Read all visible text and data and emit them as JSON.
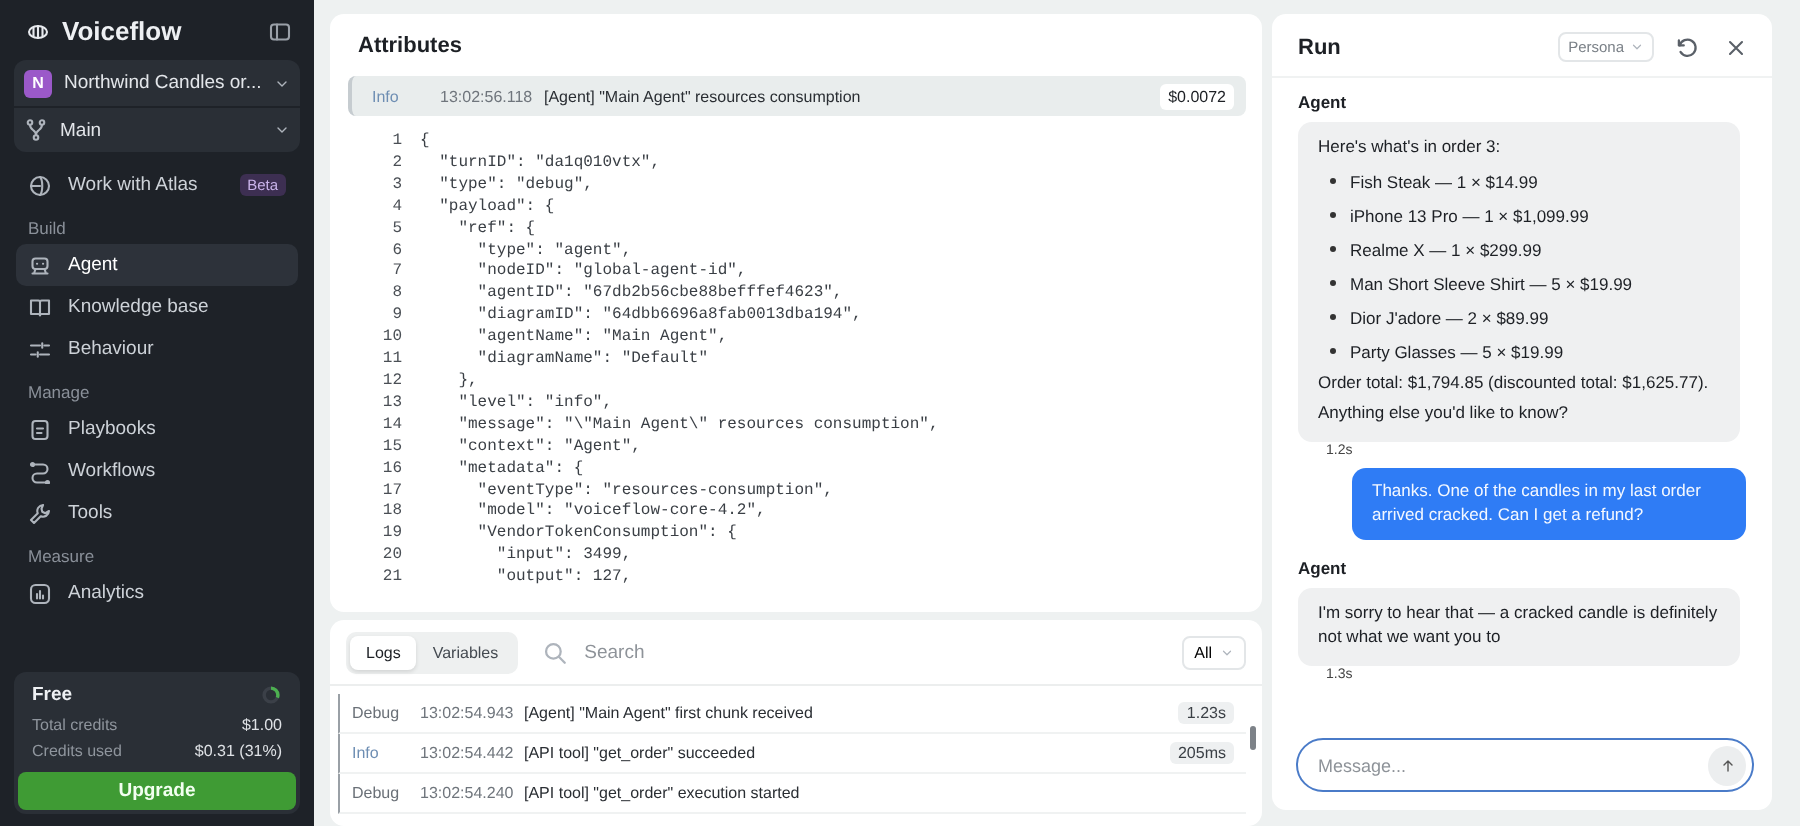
{
  "sidebar": {
    "brand": "Voiceflow",
    "project": {
      "initial": "N",
      "name": "Northwind Candles or..."
    },
    "branch": {
      "name": "Main"
    },
    "atlas": {
      "label": "Work with Atlas",
      "badge": "Beta"
    },
    "groups": [
      {
        "heading": "Build",
        "items": [
          {
            "label": "Agent",
            "selected": true
          },
          {
            "label": "Knowledge base",
            "selected": false
          },
          {
            "label": "Behaviour",
            "selected": false
          }
        ]
      },
      {
        "heading": "Manage",
        "items": [
          {
            "label": "Playbooks",
            "selected": false
          },
          {
            "label": "Workflows",
            "selected": false
          },
          {
            "label": "Tools",
            "selected": false
          }
        ]
      },
      {
        "heading": "Measure",
        "items": [
          {
            "label": "Analytics",
            "selected": false
          }
        ]
      }
    ],
    "plan": {
      "name": "Free",
      "level": 0.31,
      "rows": [
        {
          "label": "Total credits",
          "value": "$1.00"
        },
        {
          "label": "Credits used",
          "value": "$0.31 (31%)"
        }
      ],
      "button": "Upgrade"
    }
  },
  "attributes": {
    "title": "Attributes",
    "entry": {
      "level": "Info",
      "time": "13:02:56.118",
      "message": "[Agent] \"Main Agent\" resources consumption",
      "cost": "$0.0072"
    },
    "code": [
      {
        "n": "1",
        "text": "{"
      },
      {
        "n": "2",
        "text": "  \"turnID\": \"da1q010vtx\","
      },
      {
        "n": "3",
        "text": "  \"type\": \"debug\","
      },
      {
        "n": "4",
        "text": "  \"payload\": {"
      },
      {
        "n": "5",
        "text": "    \"ref\": {"
      },
      {
        "n": "6",
        "text": "      \"type\": \"agent\","
      },
      {
        "n": "7",
        "text": "      \"nodeID\": \"global-agent-id\","
      },
      {
        "n": "8",
        "text": "      \"agentID\": \"67db2b56cbe88befffef4623\","
      },
      {
        "n": "9",
        "text": "      \"diagramID\": \"64dbb6696a8fab0013dba194\","
      },
      {
        "n": "10",
        "text": "      \"agentName\": \"Main Agent\","
      },
      {
        "n": "11",
        "text": "      \"diagramName\": \"Default\""
      },
      {
        "n": "12",
        "text": "    },"
      },
      {
        "n": "13",
        "text": "    \"level\": \"info\","
      },
      {
        "n": "14",
        "text": "    \"message\": \"\\\"Main Agent\\\" resources consumption\","
      },
      {
        "n": "15",
        "text": "    \"context\": \"Agent\","
      },
      {
        "n": "16",
        "text": "    \"metadata\": {"
      },
      {
        "n": "17",
        "text": "      \"eventType\": \"resources-consumption\","
      },
      {
        "n": "18",
        "text": "      \"model\": \"voiceflow-core-4.2\","
      },
      {
        "n": "19",
        "text": "      \"VendorTokenConsumption\": {"
      },
      {
        "n": "20",
        "text": "        \"input\": 3499,"
      },
      {
        "n": "21",
        "text": "        \"output\": 127,"
      }
    ]
  },
  "logs": {
    "tabs": [
      {
        "label": "Logs",
        "selected": true
      },
      {
        "label": "Variables",
        "selected": false
      }
    ],
    "search": {
      "placeholder": "Search"
    },
    "filter": "All",
    "rows": [
      {
        "level": "Debug",
        "kind": "debug",
        "time": "13:02:54.943",
        "message": "[Agent] \"Main Agent\" first chunk received",
        "duration": "1.23s"
      },
      {
        "level": "Info",
        "kind": "info",
        "time": "13:02:54.442",
        "message": "[API tool] \"get_order\" succeeded",
        "duration": "205ms"
      },
      {
        "level": "Debug",
        "kind": "debug",
        "time": "13:02:54.240",
        "message": "[API tool] \"get_order\" execution started"
      }
    ]
  },
  "run": {
    "title": "Run",
    "persona": "Persona",
    "messages": [
      {
        "kind": "agent",
        "sender": "Agent",
        "intro": "Here's what's in order 3:",
        "items": [
          "Fish Steak — 1 × $14.99",
          "iPhone 13 Pro — 1 × $1,099.99",
          "Realme X — 1 × $299.99",
          "Man Short Sleeve Shirt — 5 × $19.99",
          "Dior J'adore — 2 × $89.99",
          "Party Glasses — 5 × $19.99"
        ],
        "paragraphs": [
          "Order total: $1,794.85 (discounted total: $1,625.77).",
          "Anything else you'd like to know?"
        ],
        "time": "1.2s"
      },
      {
        "kind": "user",
        "paragraphs": [
          "Thanks. One of the candles in my last order arrived cracked. Can I get a refund?"
        ]
      },
      {
        "kind": "agent",
        "sender": "Agent",
        "paragraphs": [
          "I'm sorry to hear that — a cracked candle is definitely not what we want you to"
        ],
        "time": "1.3s"
      }
    ],
    "input": {
      "placeholder": "Message..."
    }
  }
}
